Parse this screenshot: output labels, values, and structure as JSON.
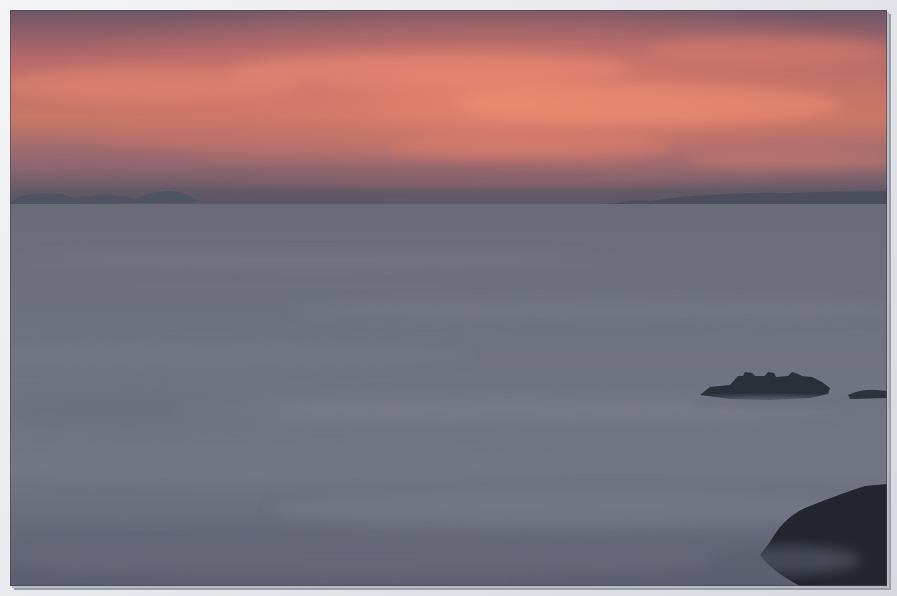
{
  "image": {
    "subject": "sunset-sky-over-sea-of-fog",
    "colors": {
      "sky_top": "#6e5667",
      "sky_glow": "#e07b68",
      "sky_low": "#7b6068",
      "horizon": "#5a5563",
      "fog_top": "#6c6d7b",
      "fog_mid": "#707381",
      "fog_bottom": "#5d6070",
      "silhouette": "#262a33",
      "frame_light": "#f4f5f8",
      "frame_dark": "#9a9ea8"
    }
  }
}
